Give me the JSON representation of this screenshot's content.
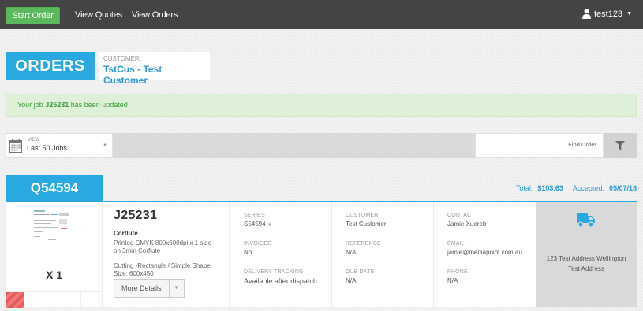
{
  "nav": {
    "start_order": "Start Order",
    "view_quotes": "View Quotes",
    "view_orders": "View Orders",
    "username": "test123",
    "user_icon": "user-icon"
  },
  "header": {
    "title": "ORDERS",
    "customer_label": "CUSTOMER",
    "customer_name": "TstCus - Test Customer"
  },
  "alert": {
    "prefix": "Your job ",
    "job": "J25231",
    "suffix": " has been updated"
  },
  "filter": {
    "view_label": "VIEW",
    "view_value": "Last 50 Jobs",
    "search_placeholder": "Find Order",
    "filter_icon": "funnel-icon"
  },
  "order": {
    "quote_id": "Q54594",
    "total_label": "Total:",
    "total_value": "$103.63",
    "accepted_label": "Accepted:",
    "accepted_value": "05/07/18",
    "quantity": "X 1",
    "job_id": "J25231",
    "product": "Corflute",
    "description": "Printed CMYK 800x600dpi x 1 side on 3mm Corflute",
    "spec_line1": "Cutting -Rectangle / Simple Shape",
    "spec_line2": "Size: 600x450",
    "more_details": "More Details",
    "series_label": "SERIES",
    "series_value": "S54594",
    "invoiced_label": "INVOICED",
    "invoiced_value": "No",
    "delivery_label": "DELIVERY TRACKING",
    "delivery_value": "Available after dispatch",
    "customer_label": "CUSTOMER",
    "customer_value": "Test Customer",
    "reference_label": "REFERENCE",
    "reference_value": "N/A",
    "due_label": "DUE DATE",
    "due_value": "N/A",
    "contact_label": "CONTACT",
    "contact_value": "Jamie Xuereb",
    "email_label": "EMAIL",
    "email_value": "jamie@mediapoint.com.au",
    "phone_label": "PHONE",
    "phone_value": "N/A",
    "address_line1": "123 Test Address Wellington",
    "address_line2": "Test Address",
    "truck_icon": "truck-icon",
    "accent_color": "#29a9df"
  }
}
